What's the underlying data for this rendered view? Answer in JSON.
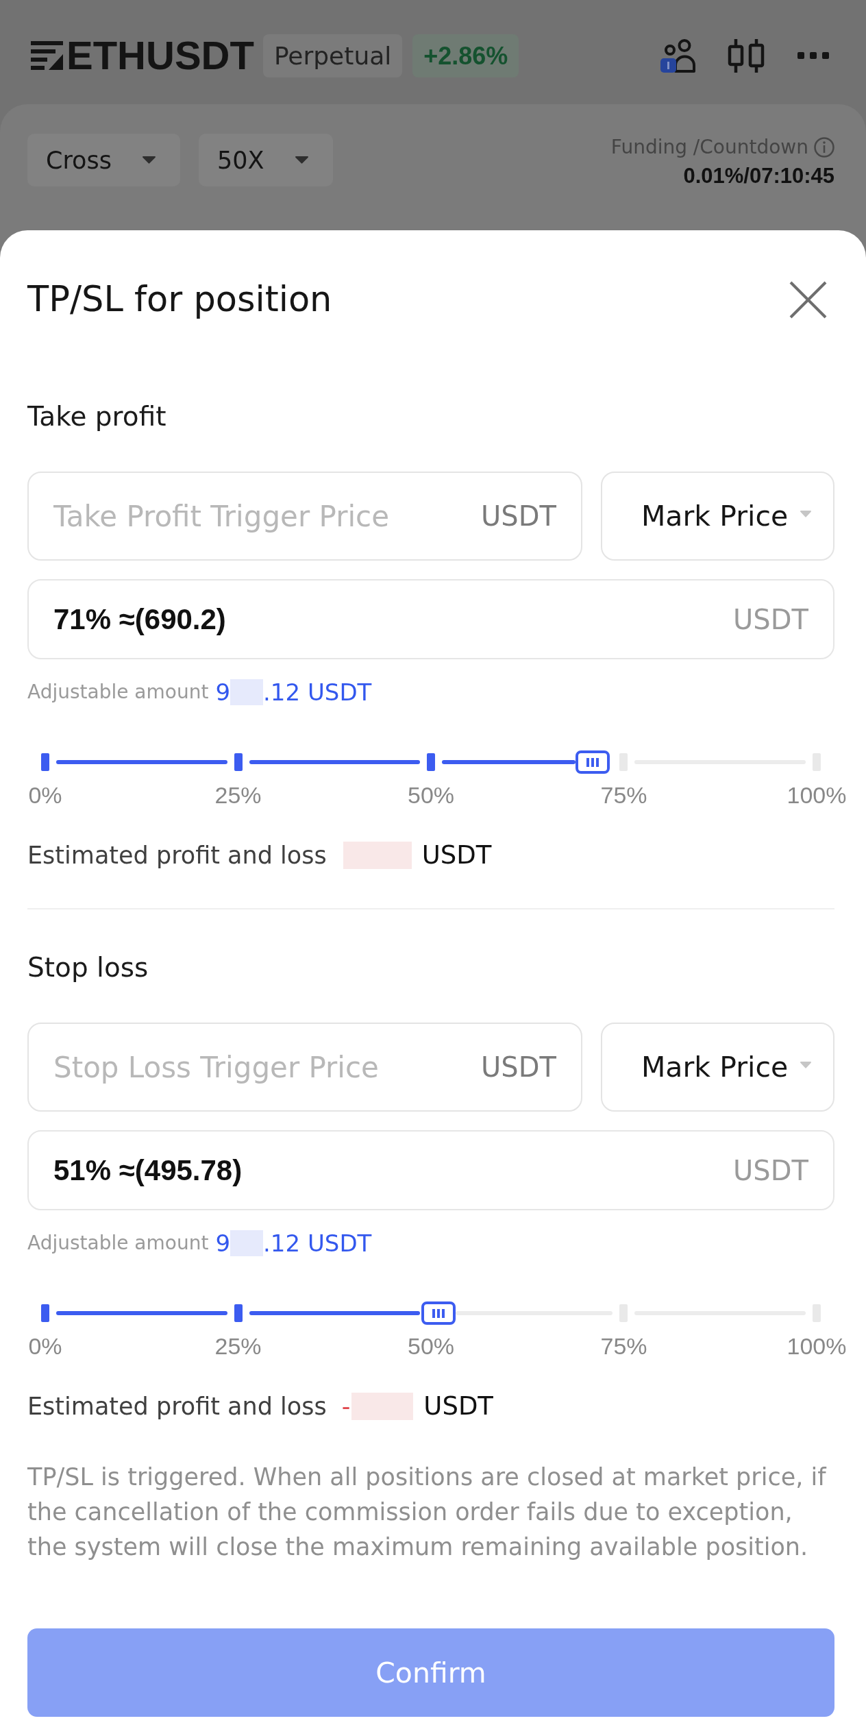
{
  "header": {
    "symbol": "ETHUSDT",
    "contract_type": "Perpetual",
    "change": "+2.86%"
  },
  "account": {
    "margin_mode": "Cross",
    "leverage": "50X",
    "funding_label": "Funding /Countdown",
    "funding_value": "0.01%/07:10:45"
  },
  "sheet": {
    "title": "TP/SL for position",
    "sections": [
      {
        "label": "Take profit",
        "trigger": {
          "placeholder": "Take Profit Trigger Price",
          "unit": "USDT"
        },
        "price_type": "Mark Price",
        "amount": {
          "value": "71% ≈(690.2)",
          "unit": "USDT"
        },
        "adjustable": {
          "label": "Adjustable amount",
          "value_start": "9",
          "redacted": true,
          "value_end": ".12 USDT"
        },
        "slider": {
          "level": 0.71,
          "labels": [
            "0%",
            "25%",
            "50%",
            "75%",
            "100%"
          ]
        },
        "pnl": {
          "label": "Estimated profit and loss",
          "redacted": true,
          "unit": "USDT"
        }
      },
      {
        "label": "Stop loss",
        "trigger": {
          "placeholder": "Stop Loss Trigger Price",
          "unit": "USDT"
        },
        "price_type": "Mark Price",
        "amount": {
          "value": "51% ≈(495.78)",
          "unit": "USDT"
        },
        "adjustable": {
          "label": "Adjustable amount",
          "value_start": "9",
          "redacted": true,
          "value_end": ".12 USDT"
        },
        "slider": {
          "level": 0.51,
          "labels": [
            "0%",
            "25%",
            "50%",
            "75%",
            "100%"
          ]
        },
        "pnl": {
          "label": "Estimated profit and loss",
          "sign": "-",
          "redacted": true,
          "unit": "USDT"
        }
      }
    ],
    "notice": "TP/SL is triggered. When all positions are closed at market price, if the cancellation of the commission order fails due to exception, the system will close the maximum remaining available position.",
    "confirm": {
      "label": "Confirm",
      "disabled": true
    }
  }
}
